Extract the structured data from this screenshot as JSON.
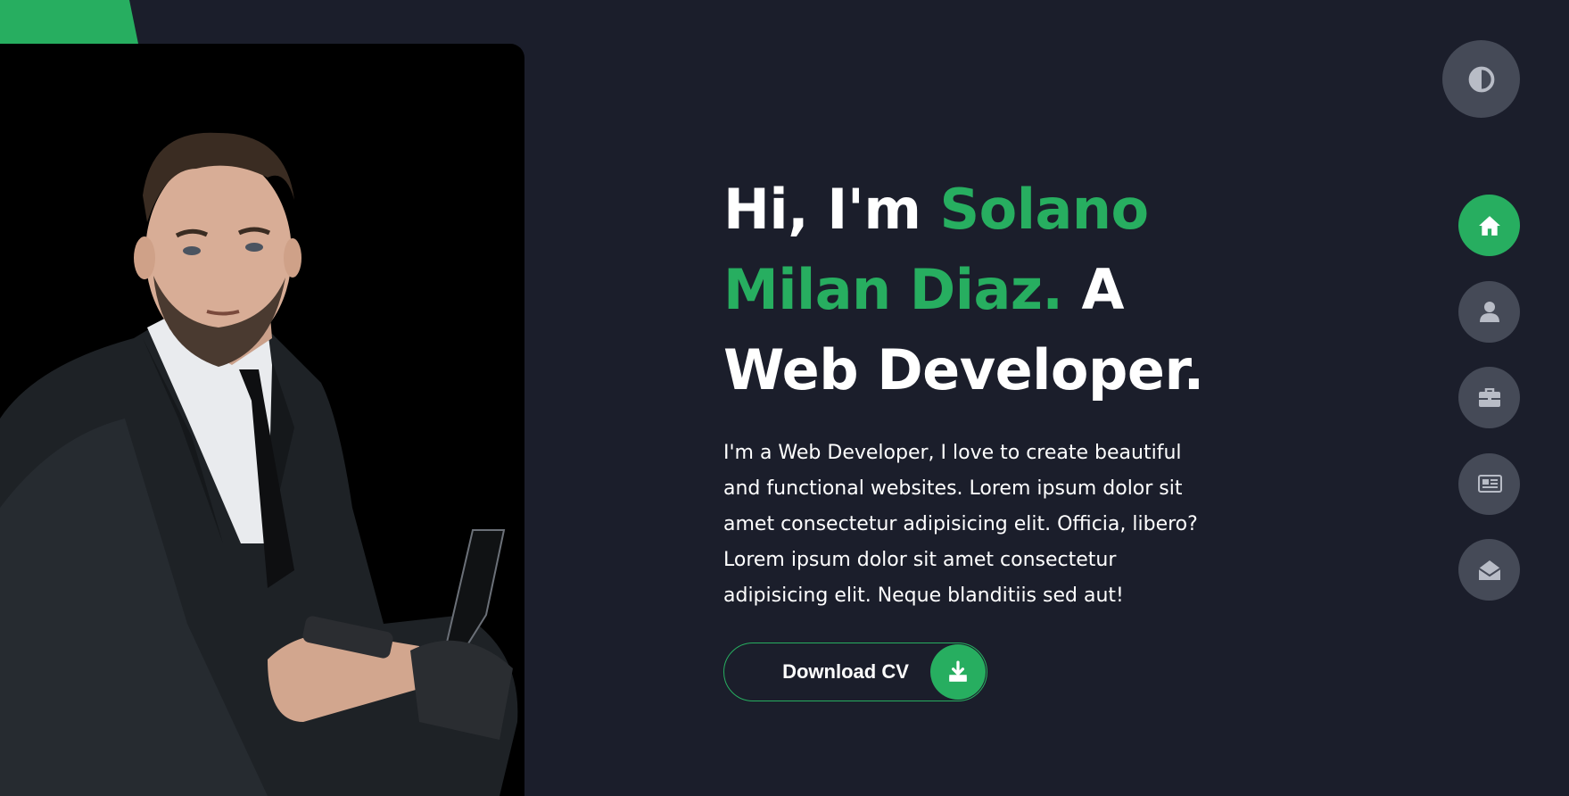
{
  "hero": {
    "title_prefix": "Hi, I'm ",
    "title_name": "Solano Milan Diaz.",
    "title_suffix": " A Web Developer.",
    "description": "I'm a Web Developer, I love to create beautiful and functional websites. Lorem ipsum dolor sit amet consectetur adipisicing elit. Officia, libero? Lorem ipsum dolor sit amet consectetur adipisicing elit. Neque blanditiis sed aut!"
  },
  "download": {
    "label": "Download CV",
    "icon": "download-icon"
  },
  "theme_toggle": {
    "icon": "contrast-icon"
  },
  "nav": {
    "items": [
      {
        "id": "home",
        "icon": "home-icon",
        "active": true
      },
      {
        "id": "about",
        "icon": "user-icon",
        "active": false
      },
      {
        "id": "portfolio",
        "icon": "briefcase-icon",
        "active": false
      },
      {
        "id": "blogs",
        "icon": "newspaper-icon",
        "active": false
      },
      {
        "id": "contact",
        "icon": "envelope-open-icon",
        "active": false
      }
    ]
  },
  "colors": {
    "background": "#1b1e2b",
    "accent": "#27ae60",
    "button_gray": "#454a57",
    "icon_gray": "#b8bcc6",
    "text": "#ffffff"
  }
}
